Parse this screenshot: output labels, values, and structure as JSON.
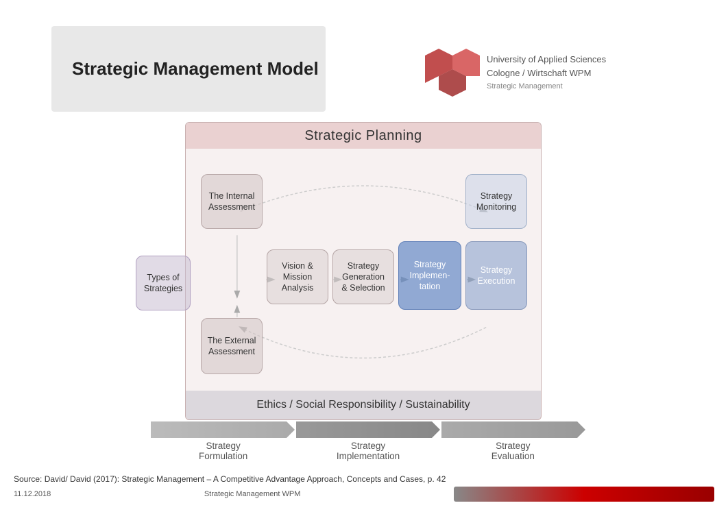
{
  "header": {
    "title": "Strategic Management Model"
  },
  "diagram": {
    "strategic_planning_label": "Strategic Planning",
    "ethics_label": "Ethics / Social Responsibility / Sustainability",
    "nodes": [
      {
        "id": "types",
        "label": "Types of\nStrategies"
      },
      {
        "id": "internal",
        "label": "The Internal\nAssessment"
      },
      {
        "id": "vision",
        "label": "Vision &\nMission\nAnalysis"
      },
      {
        "id": "generation",
        "label": "Strategy\nGeneration\n& Selection"
      },
      {
        "id": "implementation",
        "label": "Strategy\nImplemen-\ntation"
      },
      {
        "id": "execution",
        "label": "Strategy\nExecution"
      },
      {
        "id": "monitoring",
        "label": "Strategy\nMonitoring"
      },
      {
        "id": "external",
        "label": "The External\nAssessment"
      }
    ]
  },
  "bottom_phases": [
    {
      "label": "Strategy\nFormulation"
    },
    {
      "label": "Strategy\nImplementation"
    },
    {
      "label": "Strategy\nEvaluation"
    }
  ],
  "footer": {
    "source": "Source: David/ David (2017): Strategic Management – A Competitive Advantage Approach, Concepts and Cases, p. 42",
    "date": "11.12.2018",
    "subtitle": "Strategic Management WPM"
  }
}
